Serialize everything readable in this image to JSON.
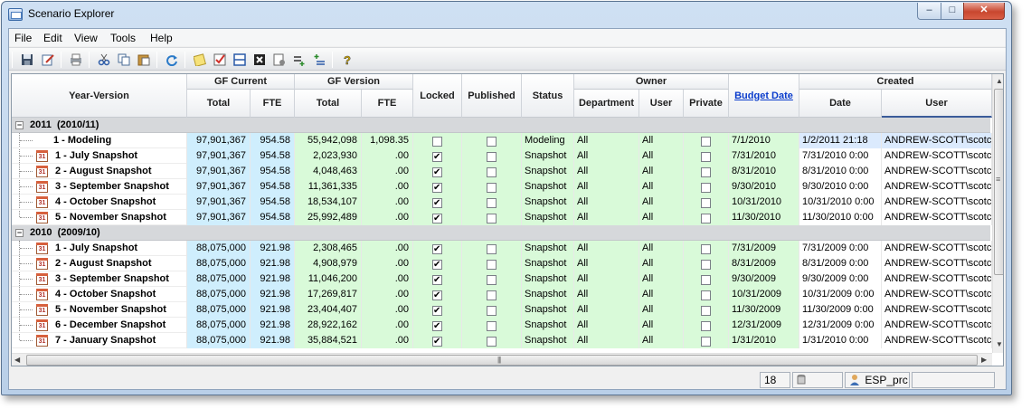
{
  "window": {
    "title": "Scenario Explorer"
  },
  "caption_buttons": {
    "minimize": "–",
    "maximize": "□",
    "close": "✕"
  },
  "menu": [
    "File",
    "Edit",
    "View",
    "Tools",
    "Help"
  ],
  "toolbar_icons": [
    "save-icon",
    "edit-icon",
    "print-icon",
    "cut-icon",
    "copy-icon",
    "paste-icon",
    "refresh-icon",
    "notes-icon",
    "check-icon",
    "layout-icon",
    "close-box-icon",
    "properties-icon",
    "add-row-icon",
    "add-column-icon",
    "help-icon"
  ],
  "headers": {
    "year_version": "Year-Version",
    "gf_current": "GF Current",
    "gf_version": "GF Version",
    "total": "Total",
    "fte": "FTE",
    "locked": "Locked",
    "published": "Published",
    "status": "Status",
    "owner": "Owner",
    "department": "Department",
    "user": "User",
    "private": "Private",
    "budget_date": "Budget Date",
    "created": "Created",
    "date": "Date"
  },
  "groups": [
    {
      "label": "2011  (2010/11)",
      "expander": "−",
      "rows": [
        {
          "name": "1 - Modeling",
          "gfc_total": "97,901,367",
          "gfc_fte": "954.58",
          "gfv_total": "55,942,098",
          "gfv_fte": "1,098.35",
          "locked": false,
          "published": false,
          "status": "Modeling",
          "department": "All",
          "user": "All",
          "private": false,
          "budget_date": "7/1/2010",
          "created_date": "1/2/2011 21:18",
          "created_user": "ANDREW-SCOTT\\scotcr",
          "icon": false,
          "selected": true
        },
        {
          "name": "1 - July Snapshot",
          "gfc_total": "97,901,367",
          "gfc_fte": "954.58",
          "gfv_total": "2,023,930",
          "gfv_fte": ".00",
          "locked": true,
          "published": false,
          "status": "Snapshot",
          "department": "All",
          "user": "All",
          "private": false,
          "budget_date": "7/31/2010",
          "created_date": "7/31/2010 0:00",
          "created_user": "ANDREW-SCOTT\\scotcr",
          "icon": true
        },
        {
          "name": "2 - August Snapshot",
          "gfc_total": "97,901,367",
          "gfc_fte": "954.58",
          "gfv_total": "4,048,463",
          "gfv_fte": ".00",
          "locked": true,
          "published": false,
          "status": "Snapshot",
          "department": "All",
          "user": "All",
          "private": false,
          "budget_date": "8/31/2010",
          "created_date": "8/31/2010 0:00",
          "created_user": "ANDREW-SCOTT\\scotcr",
          "icon": true
        },
        {
          "name": "3 - September Snapshot",
          "gfc_total": "97,901,367",
          "gfc_fte": "954.58",
          "gfv_total": "11,361,335",
          "gfv_fte": ".00",
          "locked": true,
          "published": false,
          "status": "Snapshot",
          "department": "All",
          "user": "All",
          "private": false,
          "budget_date": "9/30/2010",
          "created_date": "9/30/2010 0:00",
          "created_user": "ANDREW-SCOTT\\scotcr",
          "icon": true
        },
        {
          "name": "4 - October Snapshot",
          "gfc_total": "97,901,367",
          "gfc_fte": "954.58",
          "gfv_total": "18,534,107",
          "gfv_fte": ".00",
          "locked": true,
          "published": false,
          "status": "Snapshot",
          "department": "All",
          "user": "All",
          "private": false,
          "budget_date": "10/31/2010",
          "created_date": "10/31/2010 0:00",
          "created_user": "ANDREW-SCOTT\\scotcr",
          "icon": true
        },
        {
          "name": "5 - November Snapshot",
          "gfc_total": "97,901,367",
          "gfc_fte": "954.58",
          "gfv_total": "25,992,489",
          "gfv_fte": ".00",
          "locked": true,
          "published": false,
          "status": "Snapshot",
          "department": "All",
          "user": "All",
          "private": false,
          "budget_date": "11/30/2010",
          "created_date": "11/30/2010 0:00",
          "created_user": "ANDREW-SCOTT\\scotcr",
          "icon": true
        }
      ]
    },
    {
      "label": "2010  (2009/10)",
      "expander": "−",
      "rows": [
        {
          "name": "1 - July Snapshot",
          "gfc_total": "88,075,000",
          "gfc_fte": "921.98",
          "gfv_total": "2,308,465",
          "gfv_fte": ".00",
          "locked": true,
          "published": false,
          "status": "Snapshot",
          "department": "All",
          "user": "All",
          "private": false,
          "budget_date": "7/31/2009",
          "created_date": "7/31/2009 0:00",
          "created_user": "ANDREW-SCOTT\\scotcr",
          "icon": true
        },
        {
          "name": "2 - August Snapshot",
          "gfc_total": "88,075,000",
          "gfc_fte": "921.98",
          "gfv_total": "4,908,979",
          "gfv_fte": ".00",
          "locked": true,
          "published": false,
          "status": "Snapshot",
          "department": "All",
          "user": "All",
          "private": false,
          "budget_date": "8/31/2009",
          "created_date": "8/31/2009 0:00",
          "created_user": "ANDREW-SCOTT\\scotcr",
          "icon": true
        },
        {
          "name": "3 - September Snapshot",
          "gfc_total": "88,075,000",
          "gfc_fte": "921.98",
          "gfv_total": "11,046,200",
          "gfv_fte": ".00",
          "locked": true,
          "published": false,
          "status": "Snapshot",
          "department": "All",
          "user": "All",
          "private": false,
          "budget_date": "9/30/2009",
          "created_date": "9/30/2009 0:00",
          "created_user": "ANDREW-SCOTT\\scotcr",
          "icon": true
        },
        {
          "name": "4 - October Snapshot",
          "gfc_total": "88,075,000",
          "gfc_fte": "921.98",
          "gfv_total": "17,269,817",
          "gfv_fte": ".00",
          "locked": true,
          "published": false,
          "status": "Snapshot",
          "department": "All",
          "user": "All",
          "private": false,
          "budget_date": "10/31/2009",
          "created_date": "10/31/2009 0:00",
          "created_user": "ANDREW-SCOTT\\scotcr",
          "icon": true
        },
        {
          "name": "5 - November Snapshot",
          "gfc_total": "88,075,000",
          "gfc_fte": "921.98",
          "gfv_total": "23,404,407",
          "gfv_fte": ".00",
          "locked": true,
          "published": false,
          "status": "Snapshot",
          "department": "All",
          "user": "All",
          "private": false,
          "budget_date": "11/30/2009",
          "created_date": "11/30/2009 0:00",
          "created_user": "ANDREW-SCOTT\\scotcr",
          "icon": true
        },
        {
          "name": "6 - December Snapshot",
          "gfc_total": "88,075,000",
          "gfc_fte": "921.98",
          "gfv_total": "28,922,162",
          "gfv_fte": ".00",
          "locked": true,
          "published": false,
          "status": "Snapshot",
          "department": "All",
          "user": "All",
          "private": false,
          "budget_date": "12/31/2009",
          "created_date": "12/31/2009 0:00",
          "created_user": "ANDREW-SCOTT\\scotcr",
          "icon": true
        },
        {
          "name": "7 - January Snapshot",
          "gfc_total": "88,075,000",
          "gfc_fte": "921.98",
          "gfv_total": "35,884,521",
          "gfv_fte": ".00",
          "locked": true,
          "published": false,
          "status": "Snapshot",
          "department": "All",
          "user": "All",
          "private": false,
          "budget_date": "1/31/2010",
          "created_date": "1/31/2010 0:00",
          "created_user": "ANDREW-SCOTT\\scotcr",
          "icon": true
        }
      ]
    }
  ],
  "scroll_arrows": {
    "up": "▲",
    "down": "▼",
    "left": "◀",
    "right": "▶",
    "grip_v": "≡",
    "grip_h": "|||"
  },
  "calendar_icon_text": "31",
  "statusbar": {
    "count": "18",
    "user": "ESP_prc"
  }
}
